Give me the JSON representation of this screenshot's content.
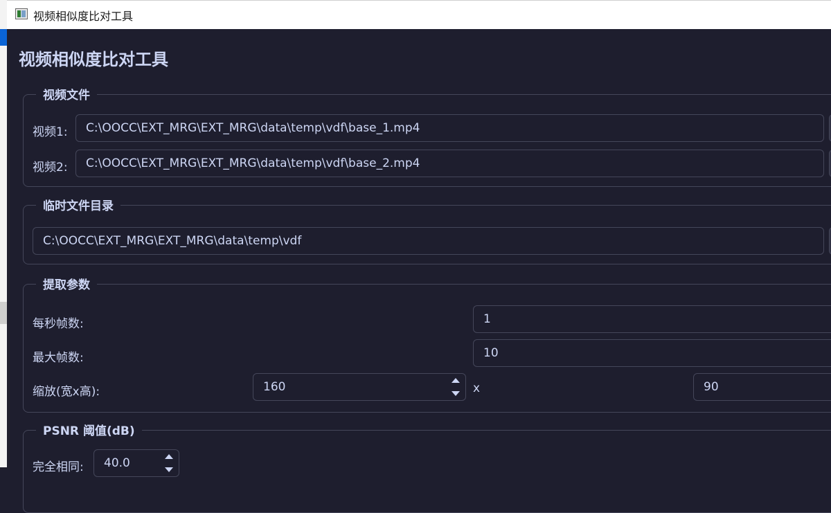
{
  "window": {
    "title": "视频相似度比对工具",
    "icon": "app-window-icon"
  },
  "page": {
    "title": "视频相似度比对工具"
  },
  "video_files": {
    "title": "视频文件",
    "video1": {
      "label": "视频1:",
      "value": "C:\\OOCC\\EXT_MRG\\EXT_MRG\\data\\temp\\vdf\\base_1.mp4"
    },
    "video2": {
      "label": "视频2:",
      "value": "C:\\OOCC\\EXT_MRG\\EXT_MRG\\data\\temp\\vdf\\base_2.mp4"
    }
  },
  "temp_dir": {
    "title": "临时文件目录",
    "value": "C:\\OOCC\\EXT_MRG\\EXT_MRG\\data\\temp\\vdf"
  },
  "extract_params": {
    "title": "提取参数",
    "fps": {
      "label": "每秒帧数:",
      "value": "1"
    },
    "max_frames": {
      "label": "最大帧数:",
      "value": "10"
    },
    "scale": {
      "label": "缩放(宽x高):",
      "width": "160",
      "separator": "x",
      "height": "90"
    }
  },
  "psnr": {
    "title": "PSNR 阈值(dB)",
    "identical": {
      "label": "完全相同:",
      "value": "40.0"
    }
  },
  "colors": {
    "background": "#1e1e2e",
    "text": "#cdd6f4",
    "border": "#45475a",
    "accent": "#0a64d6"
  }
}
